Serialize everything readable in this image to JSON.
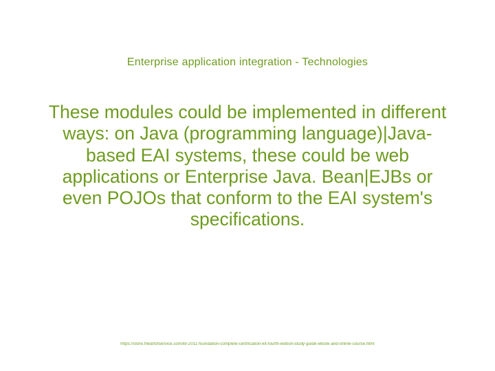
{
  "title": "Enterprise application integration -  Technologies",
  "body_text": "These modules could be implemented in different ways: on Java (programming language)|Java-based EAI systems, these could be web applications or Enterprise Java. Bean|EJBs or even POJOs that conform to the EAI system's specifications.",
  "footer_url": "https://store.theartofservice.com/itil-2011-foundation-complete-certification-kit-fourth-edition-study-guide-ebook-and-online-course.html"
}
